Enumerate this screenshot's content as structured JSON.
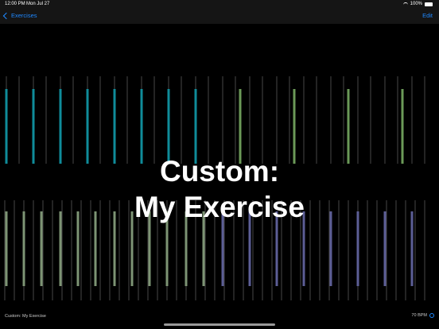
{
  "status": {
    "time": "12:00 PM",
    "date": "Mon Jul 27",
    "battery": "100%"
  },
  "nav": {
    "back_label": "Exercises",
    "edit_label": "Edit"
  },
  "main": {
    "title_line1": "Custom:",
    "title_line2": "My Exercise"
  },
  "footer": {
    "exercise_label": "Custom: My Exercise",
    "tempo": "70 BPM"
  },
  "colors": {
    "teal": "#0f8c9a",
    "green": "#6b9a58",
    "sage": "#7d9474",
    "purple": "#5c5e96",
    "accent": "#1e88ff"
  },
  "icons": [
    "wifi-icon",
    "battery-icon",
    "chevron-left-icon",
    "gear-icon"
  ]
}
